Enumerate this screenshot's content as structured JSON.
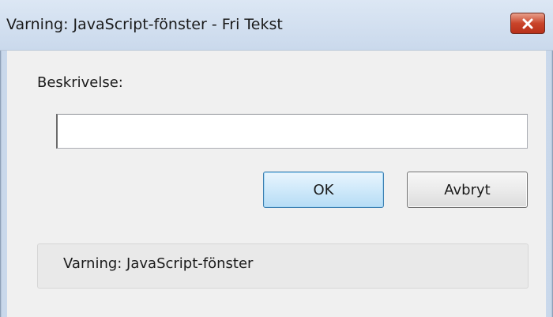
{
  "window": {
    "title": "Varning: JavaScript-fönster - Fri Tekst"
  },
  "dialog": {
    "label": "Beskrivelse:",
    "input_value": "",
    "ok_label": "OK",
    "cancel_label": "Avbryt"
  },
  "status": {
    "text": "Varning: JavaScript-fönster"
  },
  "icons": {
    "close": "close-icon"
  },
  "colors": {
    "close_button": "#c9442a",
    "ok_button_border": "#3c7fb1",
    "titlebar": "#cad9ec",
    "background": "#f0f0f0"
  }
}
